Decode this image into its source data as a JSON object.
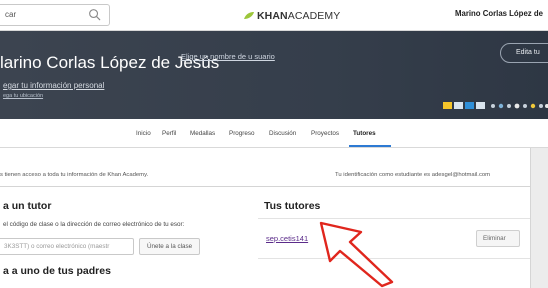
{
  "topbar": {
    "search_placeholder": "car",
    "logo_bold": "KHAN",
    "logo_light": "ACADEMY",
    "username": "Marino Corlas López de"
  },
  "hero": {
    "name": "larino Corlas López de Jesús",
    "choose_name": "Elige un nombre de u suario",
    "add_info": "egar tu información personal",
    "add_location": "ega tu ubicación",
    "edit_button": "Edita tu"
  },
  "tabs": [
    {
      "label": "Inicio"
    },
    {
      "label": "Perfil"
    },
    {
      "label": "Medallas"
    },
    {
      "label": "Progreso"
    },
    {
      "label": "Discusión"
    },
    {
      "label": "Proyectos"
    },
    {
      "label": "Tutores"
    }
  ],
  "active_tab": "Tutores",
  "main": {
    "notice": "s tienen acceso a toda tu información de Khan Academy.",
    "student_id": "Tu identificación como estudiante es adesgel@hotmail.com",
    "add_tutor_heading": "a un tutor",
    "instructions": "el código de clase o la dirección de correo electrónico de tu esor:",
    "code_placeholder": "3K3STT) o correo electrónico (maestr",
    "join_button": "Únete a la clase",
    "add_parent_heading": "a a uno de tus padres",
    "your_tutors_heading": "Tus tutores",
    "tutor_name": "sep.cetis141",
    "remove_button": "Eliminar"
  },
  "colors": {
    "hero_bg": "#363f4b",
    "tab_accent": "#2d7ad3",
    "link_purple": "#5b2c8a",
    "arrow_red": "#e0261d",
    "khan_green": "#9cc63b"
  },
  "icons": {
    "search": "magnifier-icon",
    "logo_leaf": "leaf-icon",
    "annotation": "arrow-pointer-icon"
  }
}
